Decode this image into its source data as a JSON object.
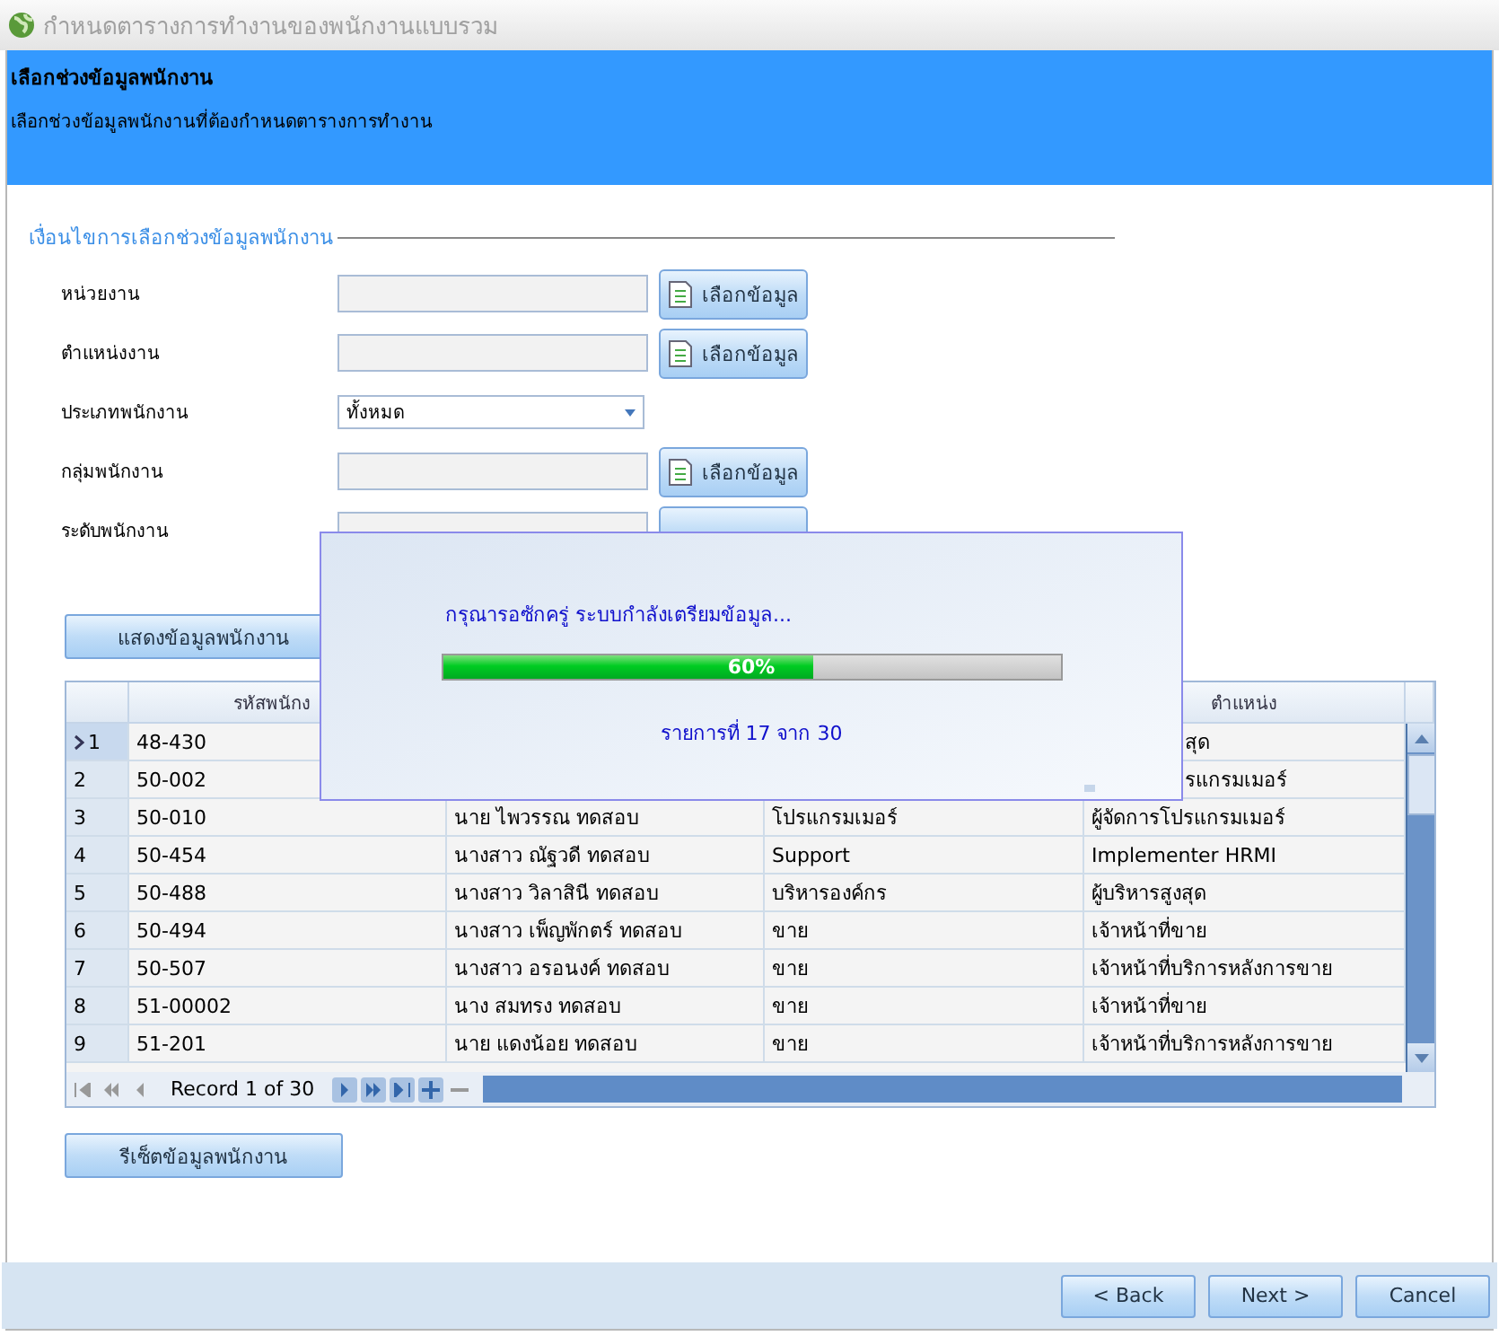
{
  "window": {
    "title": "กำหนดตารางการทำงานของพนักงานแบบรวม"
  },
  "header": {
    "title": "เลือกช่วงข้อมูลพนักงาน",
    "subtitle": "เลือกช่วงข้อมูลพนักงานที่ต้องกำหนดตารางการทำงาน"
  },
  "criteria": {
    "legend": "เงื่อนไขการเลือกช่วงข้อมูลพนักงาน",
    "fields": [
      {
        "kind": "picker",
        "label": "หน่วยงาน",
        "button": "เลือกข้อมูล"
      },
      {
        "kind": "picker",
        "label": "ตำแหน่งงาน",
        "button": "เลือกข้อมูล"
      },
      {
        "kind": "dropdown",
        "label": "ประเภทพนักงาน",
        "value": "ทั้งหมด"
      },
      {
        "kind": "picker",
        "label": "กลุ่มพนักงาน",
        "button": "เลือกข้อมูล"
      },
      {
        "kind": "picker",
        "label": "ระดับพนักงาน"
      }
    ]
  },
  "show_button": "แสดงข้อมูลพนักงาน",
  "grid": {
    "columns": [
      {
        "label": "รหัสพนักง"
      },
      {
        "label": "ตำแหน่ง"
      }
    ],
    "rows": [
      {
        "number": "1",
        "selected": true,
        "code": "48-430",
        "position": "สุด"
      },
      {
        "number": "2",
        "selected": false,
        "code": "50-002",
        "position": "รแกรมเมอร์"
      },
      {
        "number": "3",
        "selected": false,
        "code": "50-010",
        "name": "นาย ไพวรรณ ทดสอบ",
        "department": "โปรแกรมเมอร์",
        "position": "ผู้จัดการโปรแกรมเมอร์"
      },
      {
        "number": "4",
        "selected": false,
        "code": "50-454",
        "name": "นางสาว ณัฐวดี ทดสอบ",
        "department": "Support",
        "position": "Implementer HRMI"
      },
      {
        "number": "5",
        "selected": false,
        "code": "50-488",
        "name": "นางสาว วิลาสินี ทดสอบ",
        "department": "บริหารองค์กร",
        "position": "ผู้บริหารสูงสุด"
      },
      {
        "number": "6",
        "selected": false,
        "code": "50-494",
        "name": "นางสาว เพ็ญพักตร์ ทดสอบ",
        "department": "ขาย",
        "position": "เจ้าหน้าที่ขาย"
      },
      {
        "number": "7",
        "selected": false,
        "code": "50-507",
        "name": "นางสาว อรอนงค์ ทดสอบ",
        "department": "ขาย",
        "position": "เจ้าหน้าที่บริการหลังการขาย"
      },
      {
        "number": "8",
        "selected": false,
        "code": "51-00002",
        "name": "นาง สมทรง ทดสอบ",
        "department": "ขาย",
        "position": "เจ้าหน้าที่ขาย"
      },
      {
        "number": "9",
        "selected": false,
        "code": "51-201",
        "name": "นาย แดงน้อย ทดสอบ",
        "department": "ขาย",
        "position": "เจ้าหน้าที่บริการหลังการขาย"
      }
    ],
    "navigator": {
      "record": "Record 1 of 30"
    }
  },
  "reset_button": "รีเซ็ตข้อมูลพนักงาน",
  "footer": {
    "buttons": [
      "< Back",
      "Next >",
      "Cancel"
    ]
  },
  "progress": {
    "message": "กรุณารอซักครู่ ระบบกำลังเตรียมข้อมูล...",
    "level": 0.6,
    "percent": "60%",
    "status": "รายการที่ 17 จาก 30"
  }
}
